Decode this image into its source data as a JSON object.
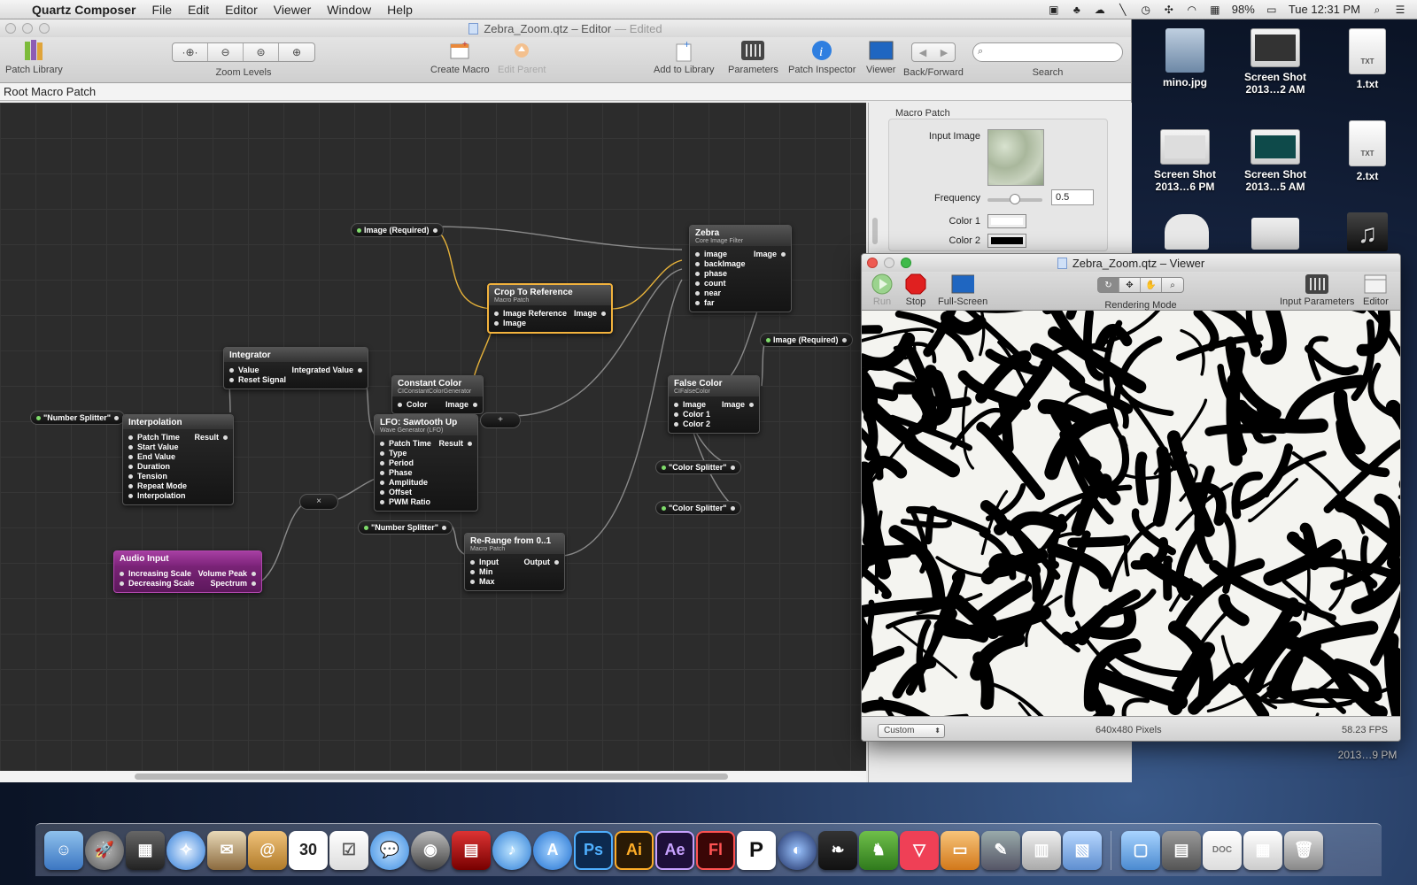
{
  "menubar": {
    "app_name": "Quartz Composer",
    "menus": [
      "File",
      "Edit",
      "Editor",
      "Viewer",
      "Window",
      "Help"
    ],
    "battery": "98%",
    "clock": "Tue 12:31 PM"
  },
  "editor": {
    "title": "Zebra_Zoom.qtz – Editor",
    "edited": "— Edited",
    "toolbar": {
      "patch_library": "Patch Library",
      "zoom_levels": "Zoom Levels",
      "create_macro": "Create Macro",
      "edit_parent": "Edit Parent",
      "add_to_library": "Add to Library",
      "parameters": "Parameters",
      "patch_inspector": "Patch Inspector",
      "viewer": "Viewer",
      "back_forward": "Back/Forward",
      "search": "Search"
    },
    "breadcrumb": "Root Macro Patch"
  },
  "nodes": {
    "image_required_1": "Image (Required)",
    "image_required_2": "Image (Required)",
    "zebra": {
      "title": "Zebra",
      "sub": "Core Image Filter",
      "inputs": [
        "image",
        "backImage",
        "phase",
        "count",
        "near",
        "far"
      ],
      "output": "Image"
    },
    "crop": {
      "title": "Crop To Reference",
      "sub": "Macro Patch",
      "inputs": [
        "Image Reference",
        "Image"
      ],
      "output": "Image"
    },
    "integrator": {
      "title": "Integrator",
      "inputs": [
        "Value",
        "Reset Signal"
      ],
      "output": "Integrated Value"
    },
    "constant_color": {
      "title": "Constant Color",
      "sub": "CIConstantColorGenerator",
      "inputs": [
        "Color"
      ],
      "output": "Image"
    },
    "number_splitter_1": "\"Number Splitter\"",
    "number_splitter_2": "\"Number Splitter\"",
    "interpolation": {
      "title": "Interpolation",
      "inputs": [
        "Patch Time",
        "Start Value",
        "End Value",
        "Duration",
        "Tension",
        "Repeat Mode",
        "Interpolation"
      ],
      "output": "Result"
    },
    "lfo": {
      "title": "LFO: Sawtooth Up",
      "sub": "Wave Generator (LFO)",
      "inputs": [
        "Patch Time",
        "Type",
        "Period",
        "Phase",
        "Amplitude",
        "Offset",
        "PWM Ratio"
      ],
      "output": "Result"
    },
    "false_color": {
      "title": "False Color",
      "sub": "CIFalseColor",
      "inputs": [
        "Image",
        "Color 1",
        "Color 2"
      ],
      "output": "Image"
    },
    "color_splitter_1": "\"Color Splitter\"",
    "color_splitter_2": "\"Color Splitter\"",
    "rerange": {
      "title": "Re-Range from 0..1",
      "sub": "Macro Patch",
      "inputs": [
        "Input",
        "Min",
        "Max"
      ],
      "output": "Output"
    },
    "audio_input": {
      "title": "Audio Input",
      "inputs": [
        "Increasing Scale",
        "Decreasing Scale"
      ],
      "outputs": [
        "Volume Peak",
        "Spectrum"
      ]
    },
    "plus_op": "+",
    "times_op": "×"
  },
  "inspector": {
    "title": "Macro Patch",
    "input_image": "Input Image",
    "frequency": "Frequency",
    "frequency_value": "0.5",
    "frequency_fraction": 0.5,
    "color1": "Color 1",
    "color2": "Color 2",
    "color1_hex": "#ffffff",
    "color2_hex": "#000000"
  },
  "viewer": {
    "title": "Zebra_Zoom.qtz – Viewer",
    "run": "Run",
    "stop": "Stop",
    "fullscreen": "Full-Screen",
    "rendering_mode": "Rendering Mode",
    "input_parameters": "Input Parameters",
    "editor": "Editor",
    "size_select": "Custom",
    "pixels": "640x480 Pixels",
    "fps": "58.23 FPS"
  },
  "desktop": {
    "icons": [
      {
        "label": "mino.jpg"
      },
      {
        "label": "Screen Shot\n2013…2 AM"
      },
      {
        "label": "1.txt",
        "badge": "TXT"
      },
      {
        "label": "Screen Shot\n2013…6 PM"
      },
      {
        "label": "Screen Shot\n2013…5 AM"
      },
      {
        "label": "2.txt",
        "badge": "TXT"
      }
    ],
    "partial_label": "2013…9 PM"
  },
  "dock": {
    "labels": {
      "ps": "Ps",
      "ai": "Ai",
      "ae": "Ae",
      "fl": "Fl",
      "calendar": "30"
    }
  },
  "colors": {
    "selection": "#f3b33d",
    "audio_node": "#8a2a86",
    "wire": "#8a8a8a",
    "wire_selected": "#e8b33a"
  }
}
